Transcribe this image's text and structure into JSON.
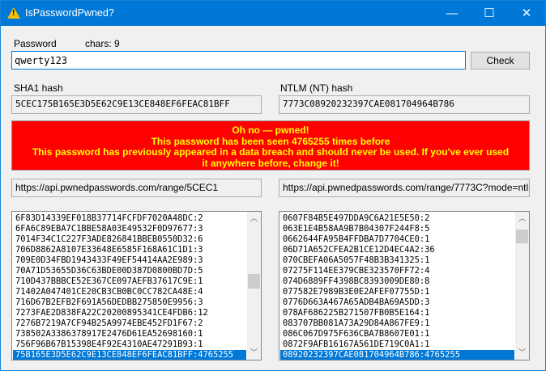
{
  "window": {
    "title": "IsPasswordPwned?",
    "minimize": "—",
    "maximize": "☐",
    "close": "✕"
  },
  "password": {
    "label": "Password",
    "chars": "chars: 9",
    "value": "qwerty123",
    "check": "Check"
  },
  "sha1": {
    "label": "SHA1 hash",
    "value": "5CEC175B165E3D5E62C9E13CE848EF6FEAC81BFF",
    "url": "https://api.pwnedpasswords.com/range/5CEC1"
  },
  "ntlm": {
    "label": "NTLM (NT) hash",
    "value": "7773C08920232397CAE081704964B786",
    "url": "https://api.pwnedpasswords.com/range/7773C?mode=ntlm"
  },
  "alert": {
    "line1": "Oh no — pwned!",
    "line2": "This password has been seen 4765255 times before",
    "line3": "This password has previously appeared in a data breach and should never be used. If you've ever used it anywhere before, change it!",
    "color": "#ff0000",
    "text_color": "#ffff00"
  },
  "sha1_list": [
    "6F83D14339EF018B37714FCFDF7020A48DC:2",
    "6FA6C89EBA7C1BBE58A03E49532F0D97677:3",
    "7014F34C1C227F3ADE826841BBEB0550D32:6",
    "706D8862A8107E33648E6585F168A61C1D1:3",
    "709E0D34FBD1943433F49EF54414AA2E989:3",
    "70A71D53655D36C63BDE00D387D0800BD7D:5",
    "710D437BBBCE52E367CE097AEFB37617C9E:1",
    "71402A047401CE20CB3CB0BC0CC782CA48E:4",
    "716D67B2EFB2F691A56DEDBB275850E9956:3",
    "7273FAE2D838FA22C20200895341CE4FDB6:12",
    "7276B7219A7CF94B25A9974EBE452FD1F67:2",
    "738502A3386378917E2476D61EA52698160:1",
    "756F96B67B15398E4F92E4310AE47291B93:1",
    "75B165E3D5E62C9E13CE848EF6FEAC81BFF:4765255"
  ],
  "ntlm_list": [
    "0607F84B5E497DDA9C6A21E5E50:2",
    "063E1E4B58AA9B7B04307F244F8:5",
    "0662644FA95B4FFDBA7D7704CE0:1",
    "06D71A652CFEA2B1CE12D4EC4A2:36",
    "070CBEFA06A5057F48B3B341325:1",
    "07275F114EE379CBE323570FF72:4",
    "074D6889FF4398BC8393009DE80:8",
    "077582E7989B3E0E2AFEF07755D:1",
    "0776D663A467A65ADB4BA69A5DD:3",
    "078AF686225B271507FB0B5E164:1",
    "083707BB081A73A29D84A867FE9:1",
    "086C067D975F636CBA7B8607E01:1",
    "0872F9AFB16167A561DE719C0A1:1",
    "08920232397CAE081704964B786:4765255"
  ]
}
